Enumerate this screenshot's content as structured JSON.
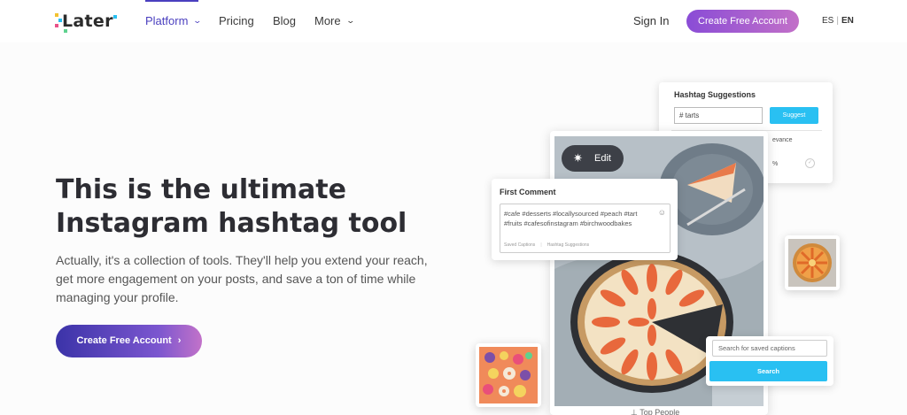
{
  "brand": {
    "logo_text": "Later",
    "accent": "#4a3fbf",
    "cta_gradient": [
      "#8a4cd6",
      "#c270c8"
    ],
    "highlight_blue": "#29c0f2"
  },
  "nav": {
    "items": [
      {
        "label": "Platform",
        "has_dropdown": true,
        "active": true
      },
      {
        "label": "Pricing",
        "has_dropdown": false
      },
      {
        "label": "Blog",
        "has_dropdown": false
      },
      {
        "label": "More",
        "has_dropdown": true
      }
    ],
    "signin_label": "Sign In",
    "cta_label": "Create Free Account",
    "lang_es": "ES",
    "lang_sep": "|",
    "lang_en": "EN"
  },
  "hero": {
    "title_line1": "This is the ultimate",
    "title_line2": "Instagram hashtag tool",
    "subtitle": "Actually, it's a collection of tools. They'll help you extend your reach, get more engagement on your posts, and save a ton of time while managing your profile.",
    "cta_label": "Create Free Account",
    "cta_arrow": "›"
  },
  "mockup": {
    "hashtag_suggestions": {
      "title": "Hashtag Suggestions",
      "input_value": "# tarts",
      "button_label": "Suggest",
      "relevance_label": "evance",
      "percent_label": "%"
    },
    "edit_button": {
      "label": "Edit",
      "icon": "magic-wand-icon"
    },
    "first_comment": {
      "title": "First Comment",
      "text": "#cafe #desserts #locallysourced #peach #tart #fruits #cafesofinstagram #birchwoodbakes",
      "footer_left": "Saved Captions",
      "footer_right": "Hashtag Suggestions"
    },
    "saved_captions": {
      "placeholder": "Search for saved captions",
      "button_label": "Search"
    },
    "bottom_label": "Top People"
  }
}
